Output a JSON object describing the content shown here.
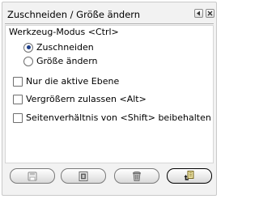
{
  "panel": {
    "title": "Zuschneiden / Größe ändern",
    "header_buttons": [
      {
        "icon": "scroll-left-icon"
      },
      {
        "icon": "close-icon"
      }
    ]
  },
  "mode": {
    "label": "Werkzeug-Modus  <Ctrl>",
    "options": [
      {
        "label": "Zuschneiden",
        "checked": true
      },
      {
        "label": "Größe ändern",
        "checked": false
      }
    ]
  },
  "options": [
    {
      "label": "Nur die aktive Ebene",
      "checked": false
    },
    {
      "label": "Vergrößern zulassen  <Alt>",
      "checked": false
    },
    {
      "label": "Seitenverhältnis von <Shift> beibehalten",
      "checked": false
    }
  ],
  "footer_buttons": [
    {
      "icon": "save-icon"
    },
    {
      "icon": "restore-icon"
    },
    {
      "icon": "delete-icon"
    },
    {
      "icon": "reset-icon"
    }
  ]
}
